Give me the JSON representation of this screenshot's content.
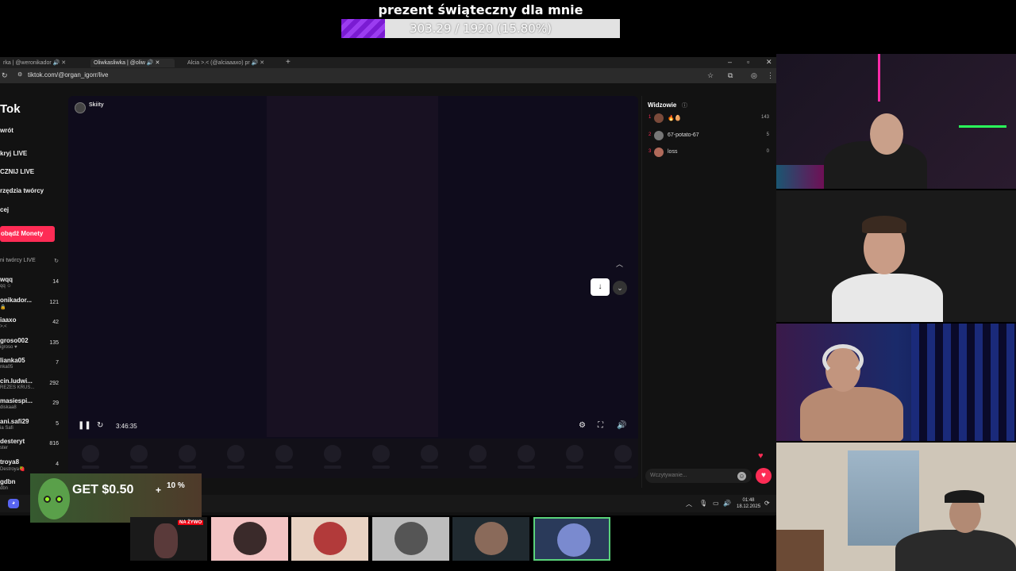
{
  "goal": {
    "title": "prezent świąteczny dla mnie",
    "progress_text": "303.29 / 1920 (15.80%)",
    "progress_fraction": 0.158
  },
  "browser": {
    "tabs": [
      {
        "label": "rka | @weronikador"
      },
      {
        "label": "Oliwkasliwka | @oliw"
      },
      {
        "label": "Alcia >.< (@alciaaaxo) pr"
      }
    ],
    "url": "tiktok.com/@organ_igorr/live"
  },
  "sidebar": {
    "logo": "Tok",
    "nav": [
      {
        "label": "wrót"
      },
      {
        "label": "kryj LIVE"
      },
      {
        "label": "CZNIJ LIVE"
      },
      {
        "label": "rzędzia twórcy"
      },
      {
        "label": "cej"
      }
    ],
    "coins_button": "obądź Monety",
    "following_header": "ni twórcy LIVE",
    "following": [
      {
        "name": "wqq",
        "sub": "qq ☺",
        "count": "14"
      },
      {
        "name": "onikador...",
        "sub": "🔒",
        "count": "121"
      },
      {
        "name": "iaaxo",
        "sub": ">.<",
        "count": "42"
      },
      {
        "name": "groso002",
        "sub": "igroso ♥",
        "count": "135"
      },
      {
        "name": "lianka05",
        "sub": "nka05",
        "count": "7"
      },
      {
        "name": "cin.ludwi...",
        "sub": "REZES KRUS...",
        "count": "292"
      },
      {
        "name": "masiespi...",
        "sub": "diskaa8",
        "count": "29"
      },
      {
        "name": "ani.safi29",
        "sub": "ia Safi",
        "count": "5"
      },
      {
        "name": "desteryt",
        "sub": "ster",
        "count": "816"
      },
      {
        "name": "troya8",
        "sub": "Destroya🍓",
        "count": "4"
      },
      {
        "name": "gdbn",
        "sub": "dbn",
        "count": ""
      }
    ]
  },
  "player": {
    "host_name": "Skiity",
    "timecode": "3:46:35"
  },
  "viewers": {
    "title": "Widzowie",
    "rows": [
      {
        "rank": "1",
        "name": "🔥🥚",
        "score": "143"
      },
      {
        "rank": "2",
        "name": "67-potato-67",
        "score": "5"
      },
      {
        "rank": "3",
        "name": "loss",
        "score": "0"
      }
    ],
    "chat_placeholder": "Wczytywanie..."
  },
  "taskbar": {
    "time": "01:48",
    "date": "18.12.2025"
  },
  "ad": {
    "text": "GET $0.50",
    "plus": "+",
    "percent": "10 %"
  },
  "thumbnails": [
    {
      "badge": "NA ŻYWO"
    },
    {
      "badge": ""
    },
    {
      "badge": ""
    },
    {
      "badge": ""
    },
    {
      "badge": ""
    },
    {
      "badge": ""
    }
  ],
  "colors": {
    "accent": "#fe2c55",
    "goal_fill": "#8a2be2",
    "selected_thumb": "#5ad37a"
  }
}
